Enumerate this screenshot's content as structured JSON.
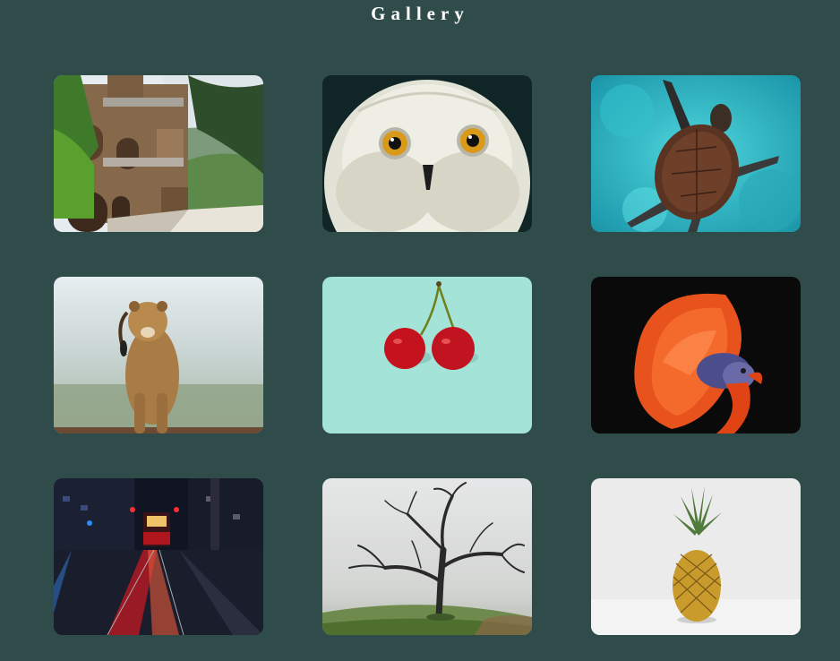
{
  "header": {
    "title": "Gallery"
  },
  "gallery": {
    "items": [
      {
        "subject": "stone-castle",
        "accent": "#8a6a48"
      },
      {
        "subject": "snowy-owl",
        "accent": "#d69a1e"
      },
      {
        "subject": "sea-turtle",
        "accent": "#1fb8c6"
      },
      {
        "subject": "lioness",
        "accent": "#b88a4e"
      },
      {
        "subject": "cherries",
        "accent": "#c4121e"
      },
      {
        "subject": "betta-fish",
        "accent": "#e8521c"
      },
      {
        "subject": "tram-at-night",
        "accent": "#d01a22"
      },
      {
        "subject": "bare-tree-in-fog",
        "accent": "#2a2a2a"
      },
      {
        "subject": "pineapple",
        "accent": "#c99a2c"
      }
    ]
  }
}
